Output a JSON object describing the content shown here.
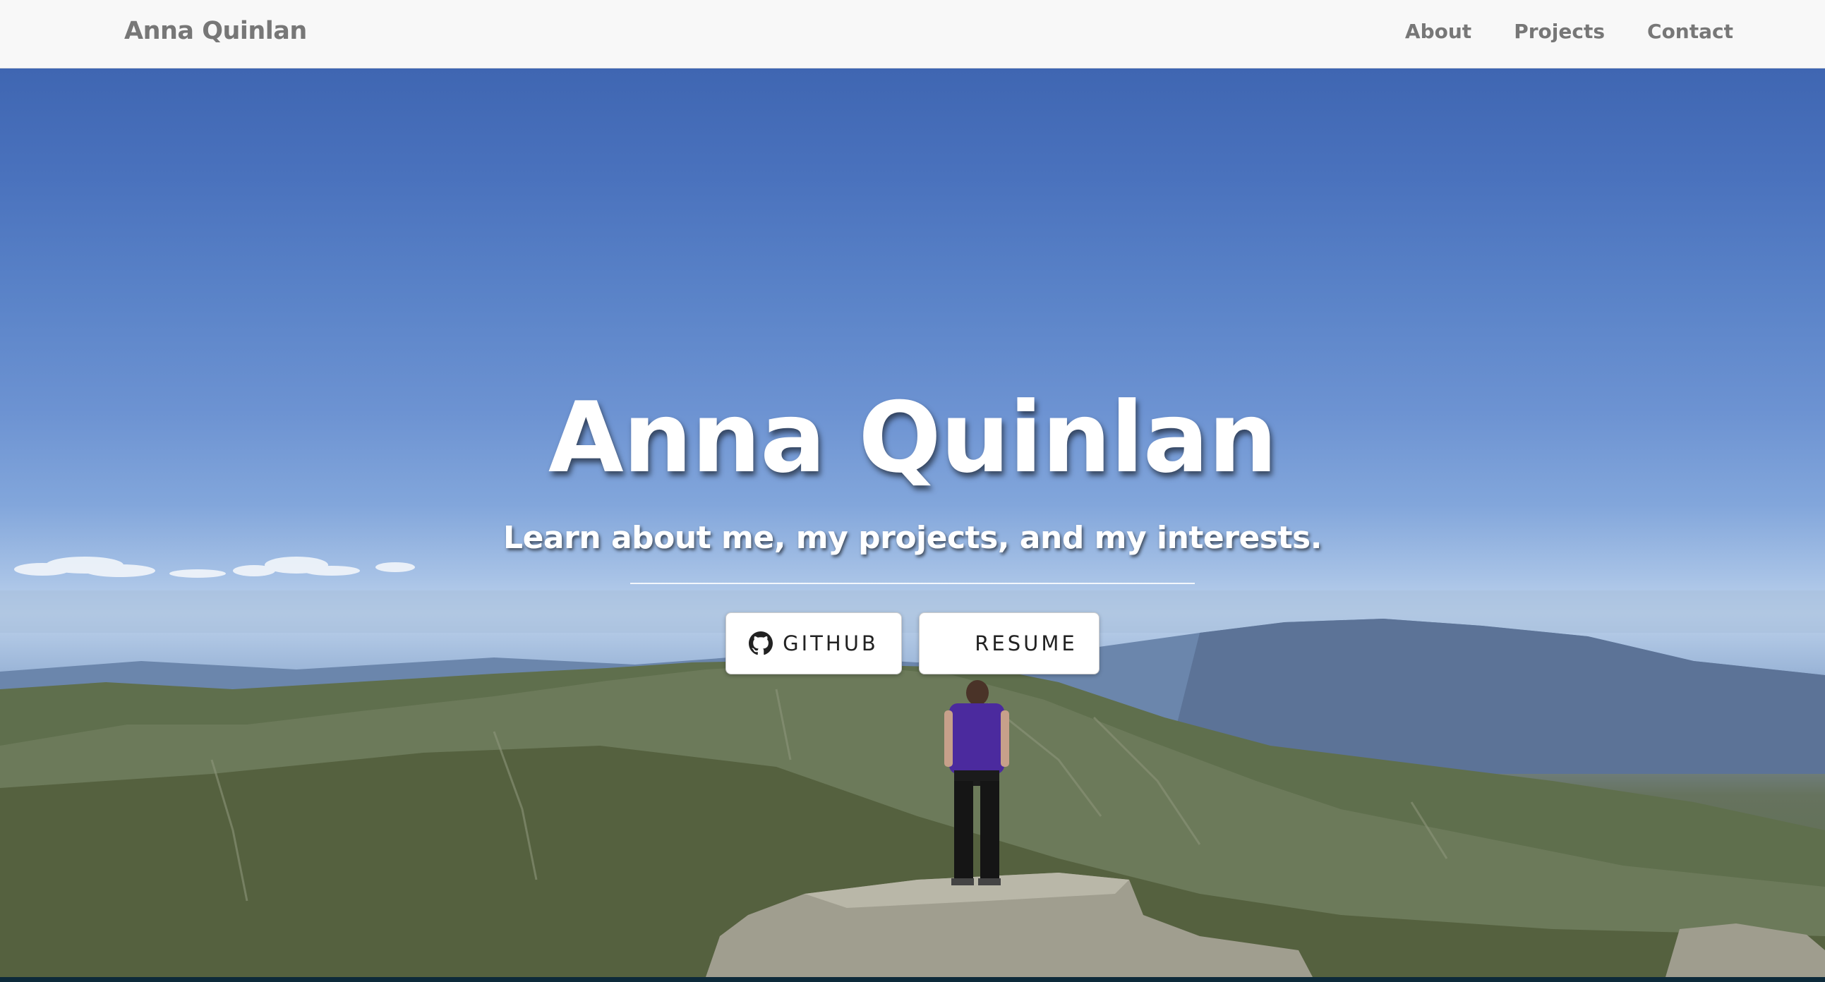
{
  "navbar": {
    "brand": "Anna Quinlan",
    "links": [
      {
        "label": "About"
      },
      {
        "label": "Projects"
      },
      {
        "label": "Contact"
      }
    ]
  },
  "hero": {
    "title": "Anna Quinlan",
    "subtitle": "Learn about me, my projects, and my interests.",
    "buttons": {
      "github": {
        "label": "GITHUB",
        "icon": "github-icon"
      },
      "resume": {
        "label": "RESUME"
      }
    },
    "background": "mountain-summit-photo"
  },
  "colors": {
    "navbar_bg": "#f8f8f8",
    "navbar_text": "#777777",
    "hero_text": "#ffffff",
    "sky": "#4a72bd",
    "button_bg": "#ffffff"
  }
}
